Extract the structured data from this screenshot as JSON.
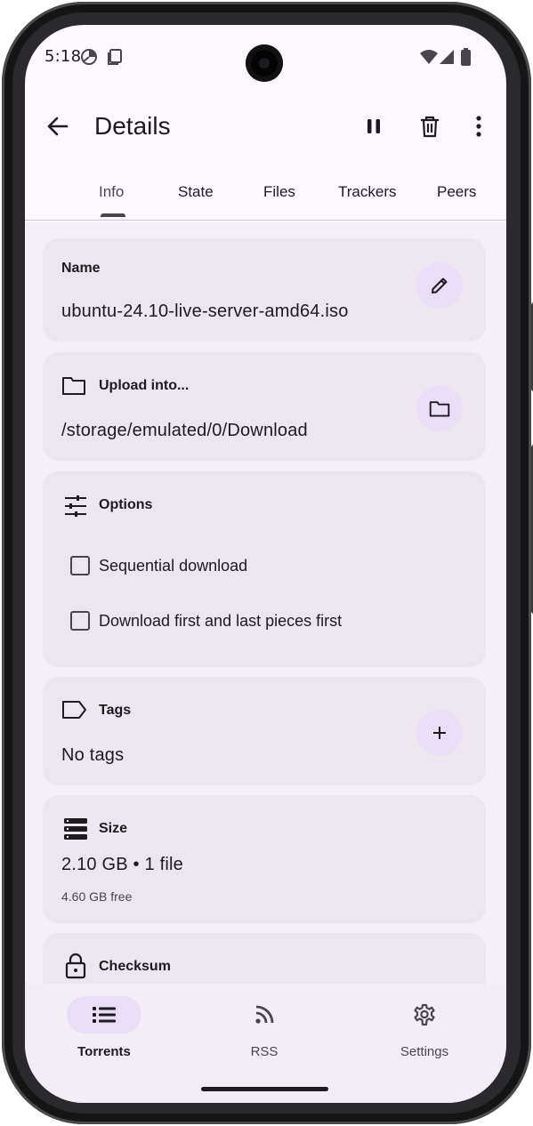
{
  "status_bar": {
    "time": "5:18"
  },
  "app_bar": {
    "title": "Details"
  },
  "tabs": [
    {
      "label": "Info",
      "active": true
    },
    {
      "label": "State",
      "active": false
    },
    {
      "label": "Files",
      "active": false
    },
    {
      "label": "Trackers",
      "active": false
    },
    {
      "label": "Peers",
      "active": false
    }
  ],
  "name_card": {
    "label": "Name",
    "value": "ubuntu-24.10-live-server-amd64.iso"
  },
  "upload_card": {
    "label": "Upload into...",
    "value": "/storage/emulated/0/Download"
  },
  "options_card": {
    "label": "Options",
    "options": [
      {
        "label": "Sequential download",
        "checked": false
      },
      {
        "label": "Download first and last pieces first",
        "checked": false
      }
    ]
  },
  "tags_card": {
    "label": "Tags",
    "value": "No tags"
  },
  "size_card": {
    "label": "Size",
    "value": "2.10 GB • 1 file",
    "free": "4.60 GB free"
  },
  "checksum_card": {
    "label": "Checksum"
  },
  "bottom_nav": [
    {
      "label": "Torrents",
      "icon": "list-icon",
      "active": true
    },
    {
      "label": "RSS",
      "icon": "rss-icon",
      "active": false
    },
    {
      "label": "Settings",
      "icon": "gear-icon",
      "active": false
    }
  ],
  "colors": {
    "surface": "#fdf7ff",
    "card": "#ece6ee",
    "accent_container": "#e8def8",
    "on_surface": "#1d1b20",
    "on_surface_variant": "#49454f"
  }
}
